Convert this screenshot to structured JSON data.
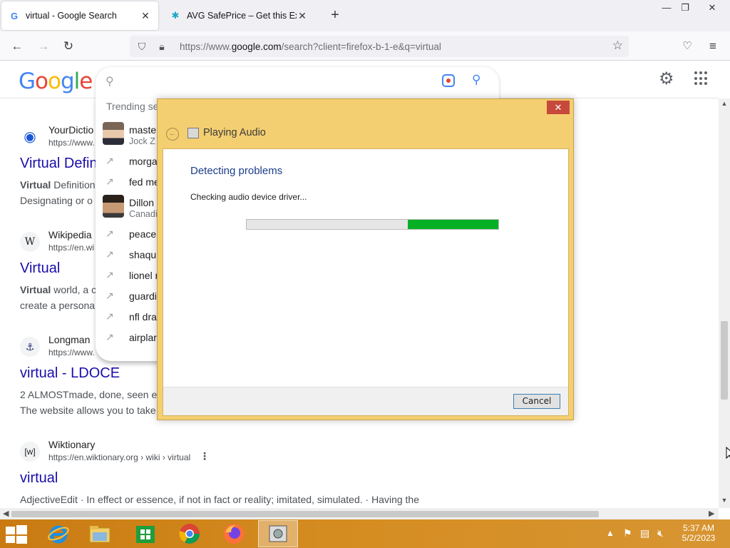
{
  "browser": {
    "tabs": [
      {
        "title": "virtual - Google Search",
        "favicon": "google-g-icon",
        "active": true
      },
      {
        "title": "AVG SafePrice – Get this Extensio",
        "favicon": "avg-safeprice-icon",
        "active": false
      }
    ],
    "url_prefix": "https://www.",
    "url_host": "google.com",
    "url_rest": "/search?client=firefox-b-1-e&q=virtual"
  },
  "google": {
    "logo_letters": [
      "G",
      "o",
      "o",
      "g",
      "l",
      "e"
    ],
    "search_value": ""
  },
  "suggestions": {
    "header": "Trending se",
    "items": [
      {
        "text": "maste",
        "sub": "Jock Z",
        "kind": "person"
      },
      {
        "text": "morga",
        "sub": "",
        "kind": "trend"
      },
      {
        "text": "fed me",
        "sub": "",
        "kind": "trend"
      },
      {
        "text": "Dillon",
        "sub": "Canadi",
        "kind": "person"
      },
      {
        "text": "peace",
        "sub": "",
        "kind": "trend"
      },
      {
        "text": "shaqu",
        "sub": "",
        "kind": "trend"
      },
      {
        "text": "lionel r",
        "sub": "",
        "kind": "trend"
      },
      {
        "text": "guardi",
        "sub": "",
        "kind": "trend"
      },
      {
        "text": "nfl dra",
        "sub": "",
        "kind": "trend"
      },
      {
        "text": "airplar",
        "sub": "",
        "kind": "trend"
      }
    ]
  },
  "results": [
    {
      "site": "YourDictio",
      "cite": "https://www.",
      "title": "Virtual Defin",
      "snippet_bold": "Virtual",
      "snippet_line1": " Definition",
      "snippet_line2": "Designating or o"
    },
    {
      "site": "Wikipedia",
      "cite": "https://en.wi",
      "title": "Virtual",
      "snippet_bold": "Virtual",
      "snippet_line1": " world, a c",
      "snippet_line2": "create a persona"
    },
    {
      "site": "Longman",
      "cite": "https://www.",
      "title": "virtual - LDOCE",
      "snippet_bold": "",
      "snippet_line1": "2 ALMOSTmade, done, seen e",
      "snippet_line2": "The website allows you to take"
    },
    {
      "site": "Wiktionary",
      "cite": "https://en.wiktionary.org › wiki › virtual",
      "title": "virtual",
      "snippet_bold": "",
      "snippet_line1": "AdjectiveEdit · In effect or essence, if not in fact or reality; imitated, simulated. · Having the",
      "snippet_line2": ""
    }
  ],
  "dialog": {
    "app_title": "Playing Audio",
    "heading": "Detecting problems",
    "status": "Checking audio device driver...",
    "progress_start": 0.64,
    "progress_end": 1.0,
    "cancel_label": "Cancel",
    "close_label": "✕"
  },
  "taskbar": {
    "items": [
      "internet-explorer-icon",
      "file-explorer-icon",
      "store-icon",
      "chrome-icon",
      "firefox-icon",
      "troubleshooter-icon"
    ],
    "time": "5:37 AM",
    "date": "5/2/2023"
  },
  "colors": {
    "dialog_frame": "#f4cf71",
    "progress_fill": "#06b025",
    "link": "#1a0dab",
    "taskbar": "#d58d22"
  }
}
